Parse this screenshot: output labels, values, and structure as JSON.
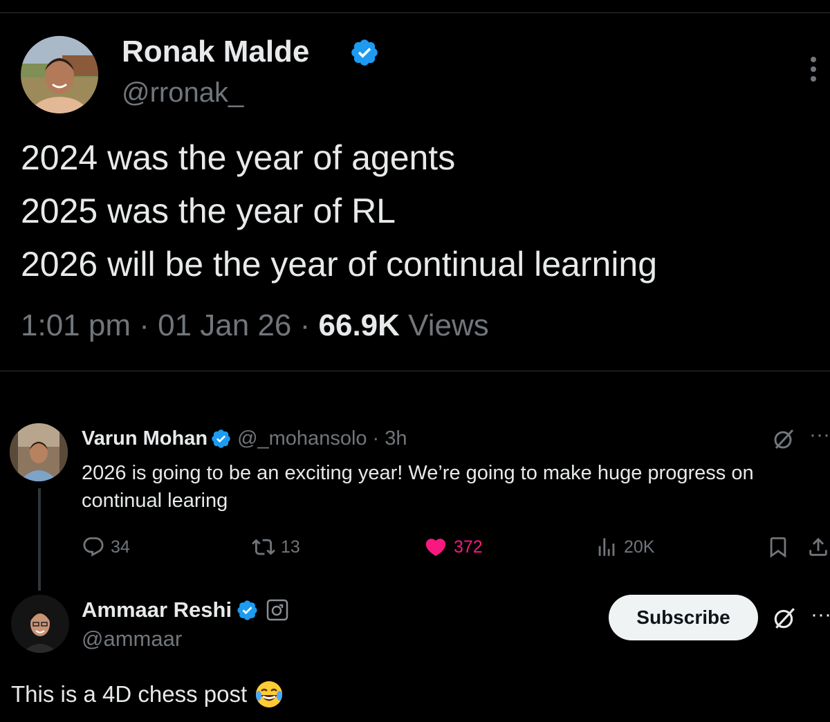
{
  "main_tweet": {
    "author_name": "Ronak Malde",
    "author_handle": "@rronak_",
    "lines": [
      "2024 was the year of agents",
      "2025 was the year of RL",
      "2026 will be the year of continual learning"
    ],
    "time": "1:01 pm",
    "date": "01 Jan 26",
    "views_count": "66.9K",
    "views_label": "Views",
    "separator": "·"
  },
  "reply": {
    "author_name": "Varun Mohan",
    "author_handle": "@_mohansolo",
    "age": "3h",
    "text_line1": "2026 is going to be an exciting year! We’re going to make huge progress on",
    "text_line2": "continual learing",
    "replies": "34",
    "reposts": "13",
    "likes": "372",
    "views": "20K"
  },
  "quote_author": {
    "name": "Ammaar Reshi",
    "handle": "@ammaar",
    "subscribe_label": "Subscribe",
    "post_text": "This is a 4D chess post"
  },
  "colors": {
    "background": "#000000",
    "verified_blue": "#1d9bf0",
    "like_pink": "#f91880",
    "muted": "#71767b",
    "text": "#e7e9ea"
  },
  "icons": [
    "verified-badge-icon",
    "more-icon",
    "grok-icon",
    "reply-icon",
    "repost-icon",
    "like-icon",
    "views-icon",
    "bookmark-icon",
    "share-icon",
    "subscribe-badge-icon",
    "laughing-emoji-icon"
  ]
}
